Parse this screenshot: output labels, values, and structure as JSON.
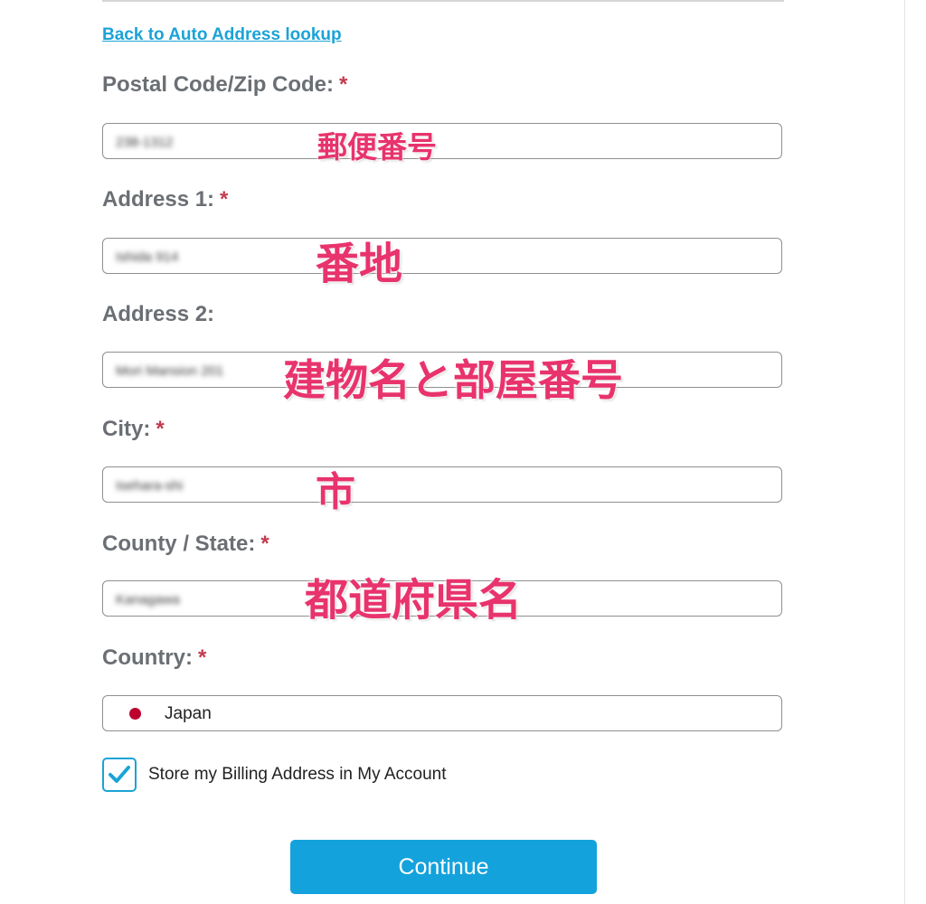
{
  "form": {
    "back_link": "Back to Auto Address lookup",
    "required_marker": "*",
    "fields": [
      {
        "label": "Postal Code/Zip Code:",
        "required": true,
        "value": "238-1312",
        "annotation": "郵便番号"
      },
      {
        "label": "Address 1:",
        "required": true,
        "value": "Ishida 914",
        "annotation": "番地"
      },
      {
        "label": "Address 2:",
        "required": false,
        "value": "Mori Mansion 201",
        "annotation": "建物名と部屋番号"
      },
      {
        "label": "City:",
        "required": true,
        "value": "Isehara-shi",
        "annotation": "市"
      },
      {
        "label": "County / State:",
        "required": true,
        "value": "Kanagawa",
        "annotation": "都道府県名"
      }
    ],
    "country": {
      "label": "Country:",
      "required": true,
      "value": "Japan",
      "flag_color": "#bc002d"
    },
    "store_address": {
      "label": "Store my Billing Address in My Account",
      "checked": true
    },
    "continue_label": "Continue"
  },
  "colors": {
    "link": "#1ba3d7",
    "label": "#6b6f74",
    "required": "#c23c4f",
    "annotation": "#e8336d",
    "button": "#14a2dc"
  },
  "icons": {
    "flag": "japan-flag-icon",
    "check": "checkmark-icon"
  }
}
